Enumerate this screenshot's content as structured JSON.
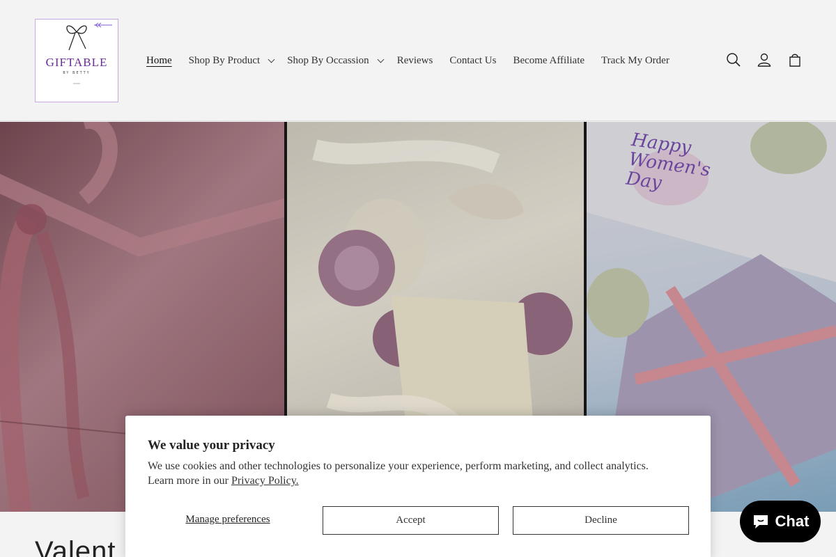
{
  "brand": {
    "logo_text": "GIFTABLE",
    "logo_sub": "BY BETTY",
    "accent_purple": "#6a2d9a"
  },
  "nav": {
    "items": [
      {
        "label": "Home",
        "active": true,
        "dropdown": false
      },
      {
        "label": "Shop By Product",
        "active": false,
        "dropdown": true
      },
      {
        "label": "Shop By Occassion",
        "active": false,
        "dropdown": true
      },
      {
        "label": "Reviews",
        "active": false,
        "dropdown": false
      },
      {
        "label": "Contact Us",
        "active": false,
        "dropdown": false
      },
      {
        "label": "Become Affiliate",
        "active": false,
        "dropdown": false
      },
      {
        "label": "Track My Order",
        "active": false,
        "dropdown": false
      }
    ]
  },
  "header_icons": [
    "search-icon",
    "account-icon",
    "cart-icon"
  ],
  "hero": {
    "panel3_text": "Happy Women's Day"
  },
  "section": {
    "title": "Valent"
  },
  "privacy": {
    "title": "We value your privacy",
    "text": "We use cookies and other technologies to personalize your experience, perform marketing, and collect analytics. Learn more in our ",
    "link": "Privacy Policy.",
    "manage": "Manage preferences",
    "accept": "Accept",
    "decline": "Decline"
  },
  "chat": {
    "label": "Chat",
    "icon": "chat-bubble-icon"
  }
}
